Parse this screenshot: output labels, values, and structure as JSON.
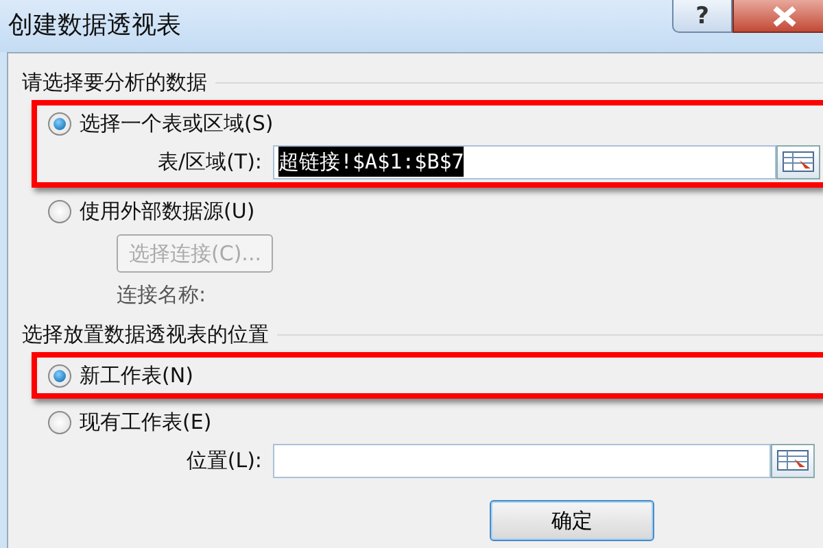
{
  "window": {
    "title": "创建数据透视表",
    "controls": [
      {
        "kind": "help",
        "label": "?"
      },
      {
        "kind": "close"
      }
    ]
  },
  "sections": [
    {
      "heading": "请选择要分析的数据",
      "options": [
        {
          "label": "选择一个表或区域(S)",
          "selected": true,
          "highlighted": true,
          "field": {
            "label": "表/区域(T):",
            "value": "超链接!$A$1:$B$7",
            "text_selected": true
          }
        },
        {
          "label": "使用外部数据源(U)",
          "selected": false,
          "highlighted": false,
          "button": {
            "label": "选择连接(C)...",
            "disabled": true
          },
          "note": "连接名称:"
        }
      ]
    },
    {
      "heading": "选择放置数据透视表的位置",
      "options": [
        {
          "label": "新工作表(N)",
          "selected": true,
          "highlighted": true
        },
        {
          "label": "现有工作表(E)",
          "selected": false,
          "highlighted": false,
          "field": {
            "label": "位置(L):"
          }
        }
      ]
    }
  ],
  "buttons": [
    {
      "label": "确定",
      "default": true
    }
  ]
}
